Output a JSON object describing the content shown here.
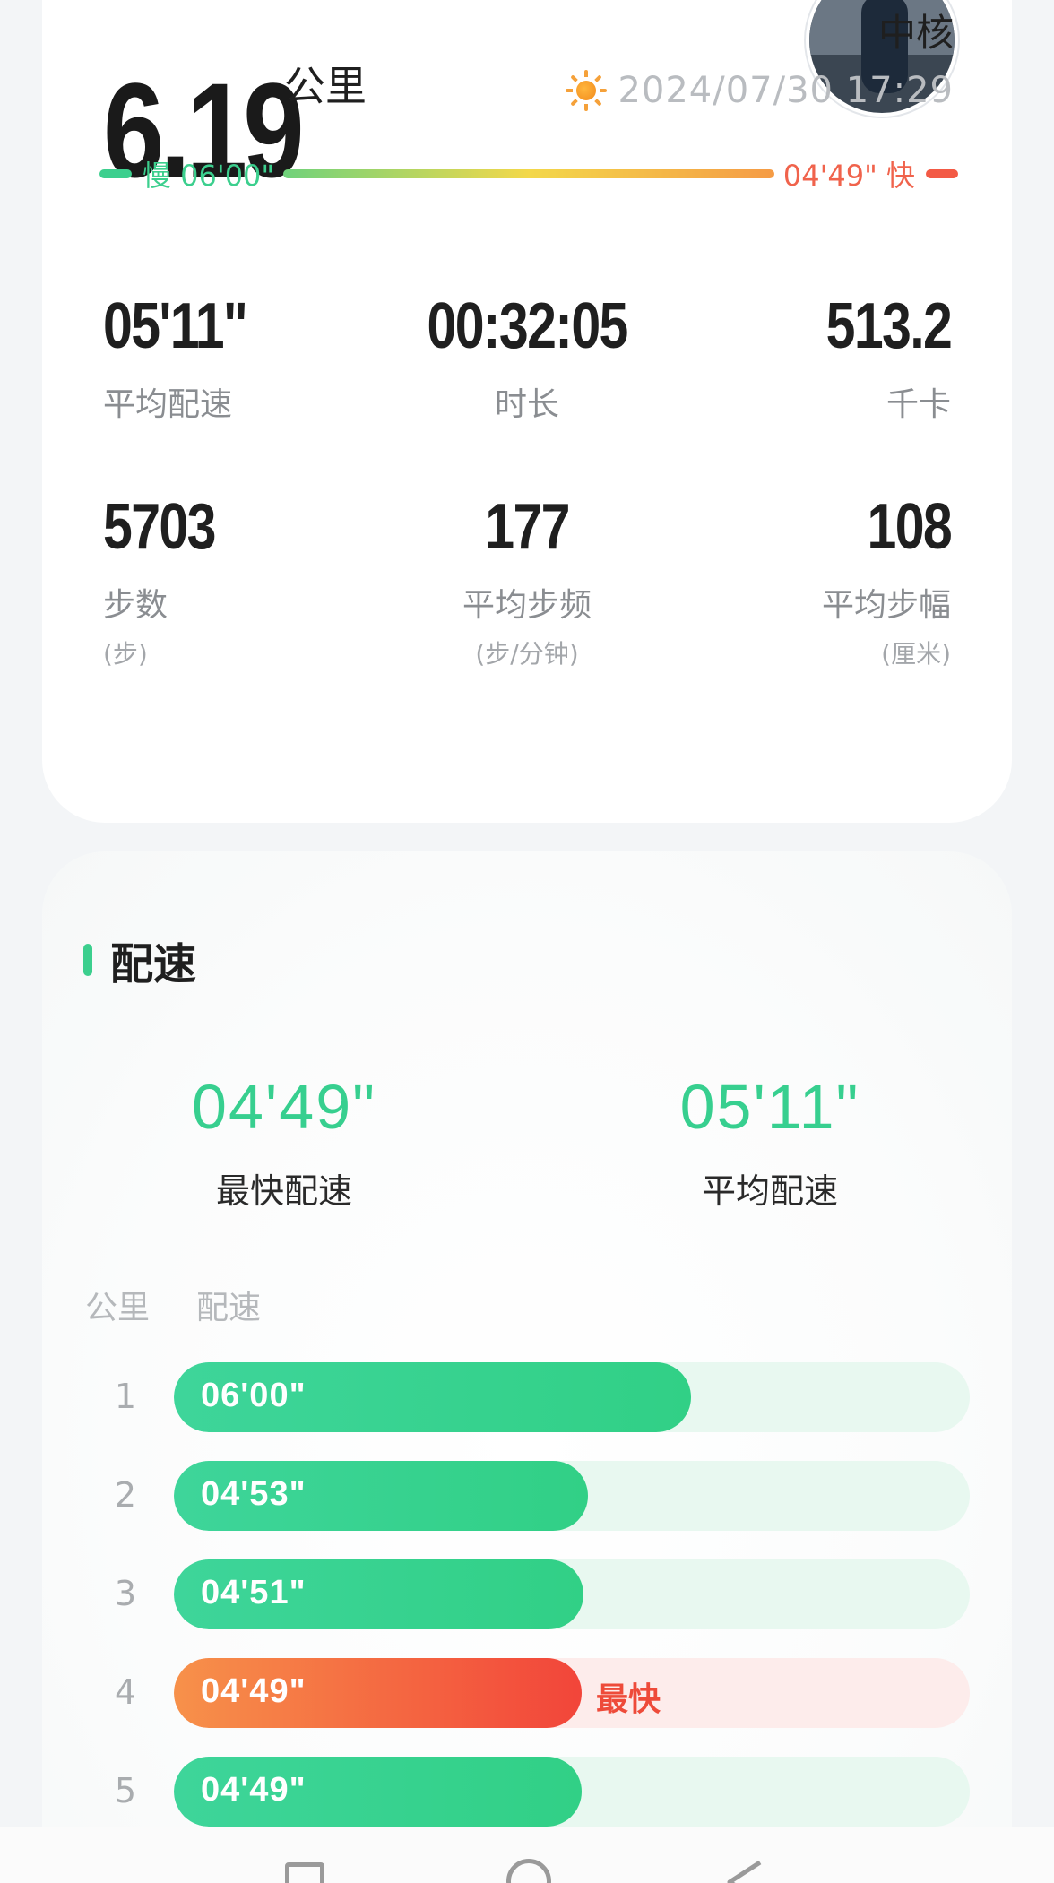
{
  "summary": {
    "distance": "6.19",
    "distance_unit": "公里",
    "city": "中核",
    "weather_icon": "sun-icon",
    "datetime": "2024/07/30 17:29",
    "pace_scale": {
      "slow_label": "慢 06'00\"",
      "fast_label": "04'49\" 快",
      "slow_color": "#3ccf8e",
      "fast_color": "#f35a45"
    },
    "stats": {
      "avg_pace": {
        "value": "05'11\"",
        "label": "平均配速"
      },
      "duration": {
        "value": "00:32:05",
        "label": "时长"
      },
      "calories": {
        "value": "513.2",
        "label": "千卡"
      },
      "steps": {
        "value": "5703",
        "label": "步数",
        "unit": "(步)"
      },
      "cadence": {
        "value": "177",
        "label": "平均步频",
        "unit": "(步/分钟)"
      },
      "stride": {
        "value": "108",
        "label": "平均步幅",
        "unit": "(厘米)"
      }
    }
  },
  "pace_section": {
    "title": "配速",
    "accent_color": "#3ccf8e",
    "fastest": {
      "value": "04'49\"",
      "label": "最快配速"
    },
    "average": {
      "value": "05'11\"",
      "label": "平均配速"
    },
    "table_headers": {
      "km": "公里",
      "pace": "配速"
    },
    "fastest_tag": "最快",
    "splits": [
      {
        "km": "1",
        "pace": "06'00\"",
        "fraction": 0.65,
        "is_fastest": false
      },
      {
        "km": "2",
        "pace": "04'53\"",
        "fraction": 0.52,
        "is_fastest": false
      },
      {
        "km": "3",
        "pace": "04'51\"",
        "fraction": 0.515,
        "is_fastest": false
      },
      {
        "km": "4",
        "pace": "04'49\"",
        "fraction": 0.512,
        "is_fastest": true
      },
      {
        "km": "5",
        "pace": "04'49\"",
        "fraction": 0.512,
        "is_fastest": false
      }
    ]
  },
  "navbar": {
    "icons": [
      "recent-apps-icon",
      "home-icon",
      "back-icon"
    ]
  }
}
